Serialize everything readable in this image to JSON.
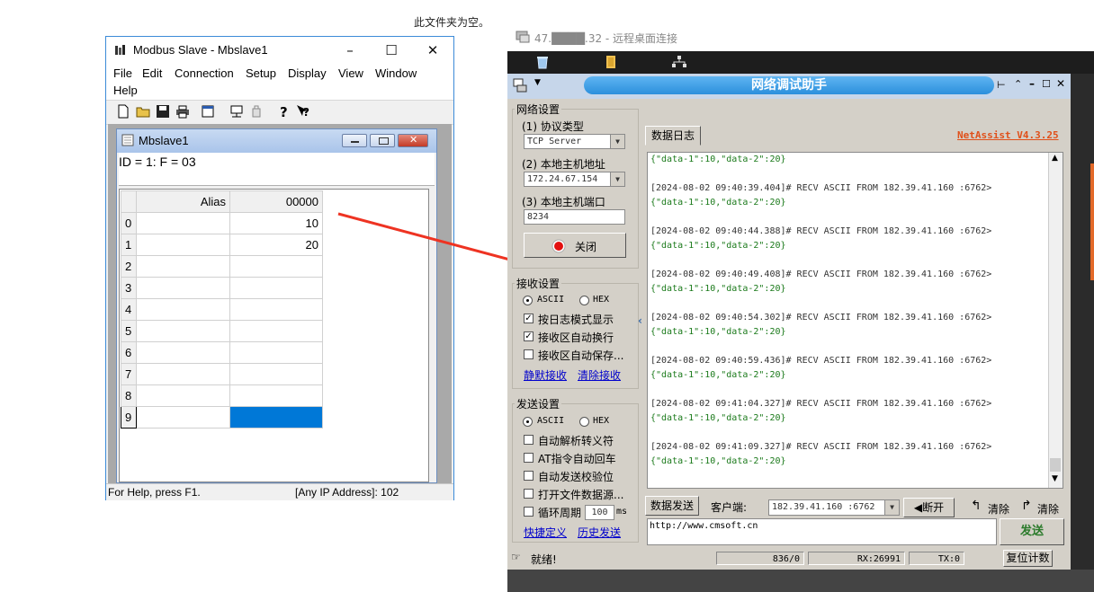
{
  "top_note": "此文件夹为空。",
  "modbus": {
    "title": "Modbus Slave - Mbslave1",
    "menu": [
      "File",
      "Edit",
      "Connection",
      "Setup",
      "Display",
      "View",
      "Window",
      "Help"
    ],
    "child_title": "Mbslave1",
    "info": "ID = 1: F = 03",
    "col_alias": "Alias",
    "col_addr": "00000",
    "rows": [
      {
        "n": "0",
        "v": "10"
      },
      {
        "n": "1",
        "v": "20"
      },
      {
        "n": "2",
        "v": ""
      },
      {
        "n": "3",
        "v": ""
      },
      {
        "n": "4",
        "v": ""
      },
      {
        "n": "5",
        "v": ""
      },
      {
        "n": "6",
        "v": ""
      },
      {
        "n": "7",
        "v": ""
      },
      {
        "n": "8",
        "v": ""
      },
      {
        "n": "9",
        "v": ""
      }
    ],
    "status_left": "For Help, press F1.",
    "status_right": "[Any IP Address]: 102"
  },
  "remote": {
    "title": "47.████.32 - 远程桌面连接"
  },
  "netassist": {
    "title": "网络调试助手",
    "version": "NetAssist V4.3.25",
    "net_settings": "网络设置",
    "protocol_label": "(1) 协议类型",
    "protocol": "TCP Server",
    "host_label": "(2) 本地主机地址",
    "host": "172.24.67.154",
    "port_label": "(3) 本地主机端口",
    "port": "8234",
    "close_btn": "关闭",
    "recv_settings": "接收设置",
    "ascii": "ASCII",
    "hex": "HEX",
    "recv_opt1": "按日志模式显示",
    "recv_opt2": "接收区自动换行",
    "recv_opt3": "接收区自动保存...",
    "link_save": "静默接收",
    "link_clear": "清除接收",
    "send_settings": "发送设置",
    "send_opt1": "自动解析转义符",
    "send_opt2": "AT指令自动回车",
    "send_opt3": "自动发送校验位",
    "send_opt4": "打开文件数据源...",
    "send_opt5": "循环周期",
    "period": "100",
    "period_unit": "ms",
    "link_shortcut": "快捷定义",
    "link_history": "历史发送",
    "log_tab": "数据日志",
    "log": [
      {
        "hdr": "",
        "data": "{\"data-1\":10,\"data-2\":20}"
      },
      {
        "hdr": "[2024-08-02 09:40:39.404]# RECV ASCII FROM 182.39.41.160 :6762>",
        "data": "{\"data-1\":10,\"data-2\":20}"
      },
      {
        "hdr": "[2024-08-02 09:40:44.388]# RECV ASCII FROM 182.39.41.160 :6762>",
        "data": "{\"data-1\":10,\"data-2\":20}"
      },
      {
        "hdr": "[2024-08-02 09:40:49.408]# RECV ASCII FROM 182.39.41.160 :6762>",
        "data": "{\"data-1\":10,\"data-2\":20}"
      },
      {
        "hdr": "[2024-08-02 09:40:54.302]# RECV ASCII FROM 182.39.41.160 :6762>",
        "data": "{\"data-1\":10,\"data-2\":20}"
      },
      {
        "hdr": "[2024-08-02 09:40:59.436]# RECV ASCII FROM 182.39.41.160 :6762>",
        "data": "{\"data-1\":10,\"data-2\":20}"
      },
      {
        "hdr": "[2024-08-02 09:41:04.327]# RECV ASCII FROM 182.39.41.160 :6762>",
        "data": "{\"data-1\":10,\"data-2\":20}"
      },
      {
        "hdr": "[2024-08-02 09:41:09.327]# RECV ASCII FROM 182.39.41.160 :6762>",
        "data": "{\"data-1\":10,\"data-2\":20}"
      }
    ],
    "send_tab": "数据发送",
    "client_label": "客户端:",
    "client": "182.39.41.160 :6762",
    "disconnect": "断开",
    "clear1": "清除",
    "clear2": "清除",
    "send_text": "http://www.cmsoft.cn",
    "send_btn": "发送",
    "status_ready": "就绪!",
    "count": "836/0",
    "rx": "RX:26991",
    "tx": "TX:0",
    "reset": "复位计数"
  }
}
